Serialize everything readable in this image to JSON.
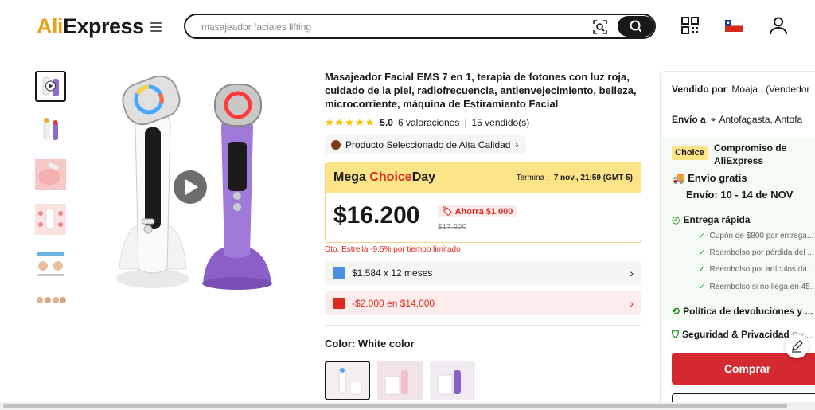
{
  "header": {
    "logo_prefix": "Ali",
    "logo_suffix": "Express",
    "search_placeholder": "masajeador faciales lifting"
  },
  "product": {
    "title": "Masajeador Facial EMS 7 en 1, terapia de fotones con luz roja, cuidado de la piel, radiofrecuencia, antienvejecimiento, belleza, microcorriente, máquina de Estiramiento Facial",
    "stars": "★★★★★",
    "rating_score": "5.0",
    "rating_count": "6 valoraciones",
    "sold": "15 vendido(s)",
    "quality_badge": "Producto Seleccionado de Alta Calidad",
    "deal_title_prefix": "Mega ",
    "deal_title_choice": "Choice",
    "deal_title_suffix": "Day",
    "deal_ends_label": "Termina :",
    "deal_ends_value": "7 nov., 21:59 (GMT-5)",
    "price": "$16.200",
    "save_text": "Ahorra $1.000",
    "original_price": "$17.200",
    "star_discount": "Dto. Estrella -9.5% por tiempo limitado",
    "installments": "$1.584 x 12 meses",
    "coupon": "-$2.000 en $14.000",
    "color_label": "Color: White color"
  },
  "panel": {
    "sold_by_label": "Vendido por",
    "sold_by_value": "Moaja...(Vendedor",
    "ship_to_label": "Envío a",
    "ship_to_value": "Antofagasta, Antofa",
    "choice_badge": "Choice",
    "choice_commitment_1": "Compromiso de",
    "choice_commitment_2": "AliExpress",
    "free_shipping": "Envío gratis",
    "delivery": "Envío: 10 - 14 de NOV",
    "fast_delivery": "Entrega rápida",
    "benefits": [
      "Cupón de $800 por entrega...",
      "Reembolso por pérdida del ...",
      "Reembolso por artículos da...",
      "Reembolso si no llega en 45..."
    ],
    "returns": "Política de devoluciones y ...",
    "security": "Seguridad & Privacidad",
    "security_more": "Pag...",
    "buy_label": "Comprar"
  },
  "colors": {
    "accent_red": "#d3292f",
    "choice_yellow": "#fde487",
    "success_green": "#0a8800"
  }
}
